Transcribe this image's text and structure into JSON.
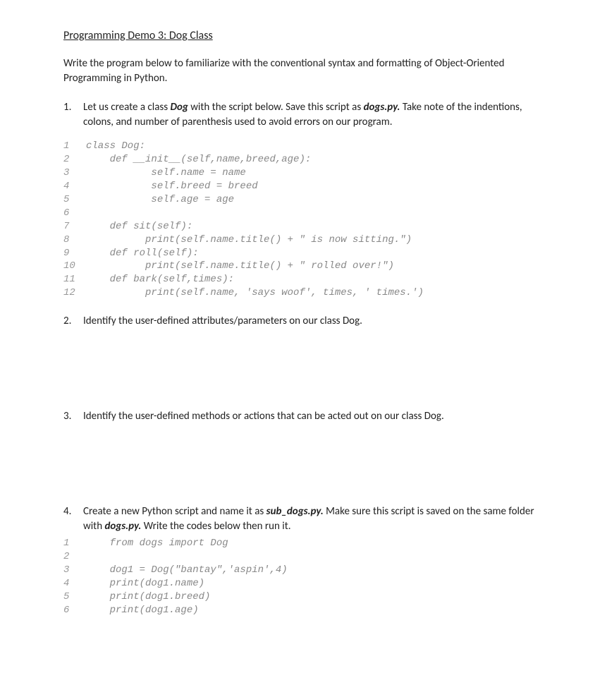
{
  "title": "Programming Demo 3: Dog Class",
  "intro": "Write the program below to familiarize with the conventional syntax and formatting of Object-Oriented Programming in Python.",
  "steps": {
    "s1_num": "1.",
    "s1_a": "Let us create a class ",
    "s1_b": "Dog",
    "s1_c": " with the script below. Save this script as ",
    "s1_d": "dogs.py.",
    "s1_e": " Take note of the indentions, colons, and number of parenthesis used to avoid errors on our program.",
    "s2_num": "2.",
    "s2": "Identify the user-defined attributes/parameters on our class Dog.",
    "s3_num": "3.",
    "s3": "Identify the user-defined methods or actions that can be acted out on our class Dog.",
    "s4_num": "4.",
    "s4_a": "Create a new Python script and name it as ",
    "s4_b": "sub_dogs.py.",
    "s4_c": " Make sure this script is saved on the same folder with ",
    "s4_d": "dogs.py.",
    "s4_e": " Write the codes below then run it."
  },
  "code1": {
    "l1": {
      "n": "1",
      "c": "class Dog:"
    },
    "l2": {
      "n": "2",
      "c": "    def __init__(self,name,breed,age):"
    },
    "l3": {
      "n": "3",
      "c": "           self.name = name"
    },
    "l4": {
      "n": "4",
      "c": "           self.breed = breed"
    },
    "l5": {
      "n": "5",
      "c": "           self.age = age"
    },
    "l6": {
      "n": "6",
      "c": ""
    },
    "l7": {
      "n": "7",
      "c": "    def sit(self):"
    },
    "l8": {
      "n": "8",
      "c": "          print(self.name.title() + \" is now sitting.\")"
    },
    "l9": {
      "n": "9",
      "c": "    def roll(self):"
    },
    "l10": {
      "n": "10",
      "c": "          print(self.name.title() + \" rolled over!\")"
    },
    "l11": {
      "n": "11",
      "c": "    def bark(self,times):"
    },
    "l12": {
      "n": "12",
      "c": "          print(self.name, 'says woof', times, ' times.')"
    }
  },
  "code2": {
    "l1": {
      "n": "1",
      "c": "    from dogs import Dog"
    },
    "l2": {
      "n": "2",
      "c": ""
    },
    "l3": {
      "n": "3",
      "c": "    dog1 = Dog(\"bantay\",'aspin',4)"
    },
    "l4": {
      "n": "4",
      "c": "    print(dog1.name)"
    },
    "l5": {
      "n": "5",
      "c": "    print(dog1.breed)"
    },
    "l6": {
      "n": "6",
      "c": "    print(dog1.age)"
    }
  }
}
